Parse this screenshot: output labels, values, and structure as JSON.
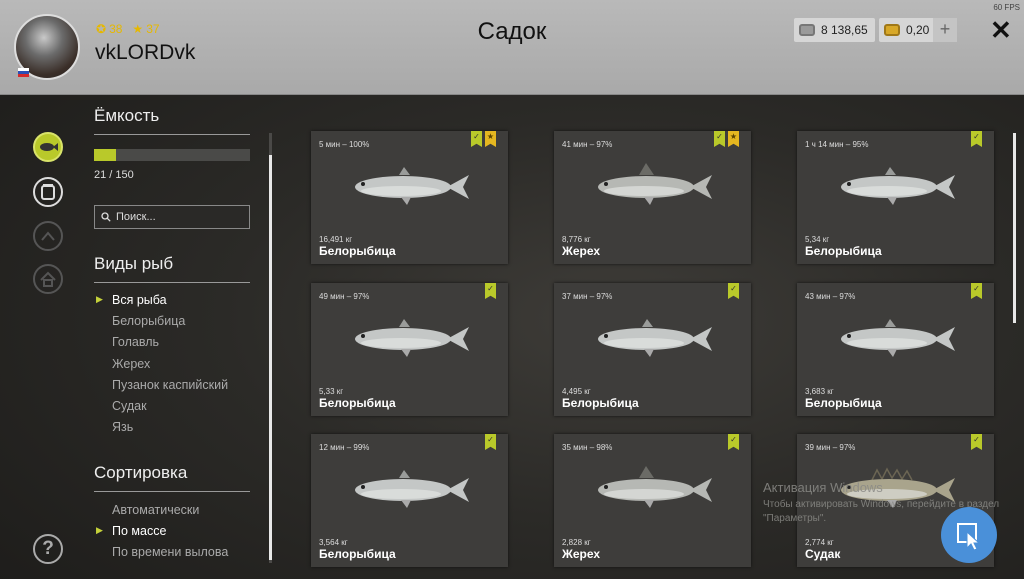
{
  "header": {
    "username": "vkLORDvk",
    "level": "38",
    "rank": "37",
    "title": "Садок",
    "silver": "8 138,65",
    "gold": "0,20",
    "plus": "+",
    "close": "✕",
    "fps": "60 FPS"
  },
  "sidebar": {
    "capacity_title": "Ёмкость",
    "capacity_value": "21 / 150",
    "capacity_fraction": 0.14,
    "search_placeholder": "Поиск...",
    "species_title": "Виды рыб",
    "species": [
      "Вся рыба",
      "Белорыбица",
      "Голавль",
      "Жерех",
      "Пузанок каспийский",
      "Судак",
      "Язь"
    ],
    "sort_title": "Сортировка",
    "sort": [
      "Автоматически",
      "По массе",
      "По времени вылова"
    ],
    "help": "?"
  },
  "colors": {
    "accent": "#b9c92a",
    "star": "#e5b720",
    "header": "#b0b0b0"
  },
  "cards": [
    {
      "time": "5 мин – 100%",
      "weight": "16,491 кг",
      "name": "Белорыбица",
      "star": true
    },
    {
      "time": "41 мин – 97%",
      "weight": "8,776 кг",
      "name": "Жерех",
      "star": true
    },
    {
      "time": "1 ч 14 мин – 95%",
      "weight": "5,34 кг",
      "name": "Белорыбица",
      "star": false
    },
    {
      "time": "49 мин – 97%",
      "weight": "5,33 кг",
      "name": "Белорыбица",
      "star": false
    },
    {
      "time": "37 мин – 97%",
      "weight": "4,495 кг",
      "name": "Белорыбица",
      "star": false
    },
    {
      "time": "43 мин – 97%",
      "weight": "3,683 кг",
      "name": "Белорыбица",
      "star": false
    },
    {
      "time": "12 мин – 99%",
      "weight": "3,564 кг",
      "name": "Белорыбица",
      "star": false
    },
    {
      "time": "35 мин – 98%",
      "weight": "2,828 кг",
      "name": "Жерех",
      "star": false
    },
    {
      "time": "39 мин – 97%",
      "weight": "2,774 кг",
      "name": "Судак",
      "star": false
    }
  ],
  "watermark": {
    "line1": "Активация Windows",
    "line2": "Чтобы активировать Windows, перейдите в раздел \"Параметры\"."
  }
}
